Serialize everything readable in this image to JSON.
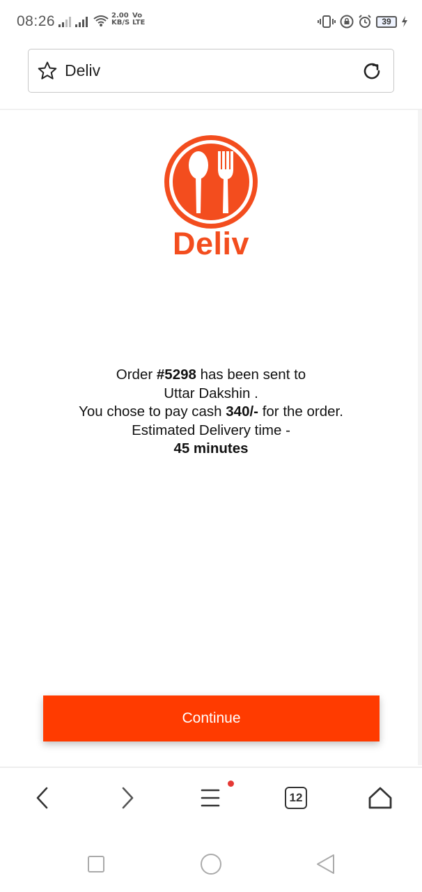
{
  "status_bar": {
    "time": "08:26",
    "speed_value": "2.00",
    "speed_unit": "KB/S",
    "network_top": "Vo",
    "network_bottom": "LTE",
    "battery": "39"
  },
  "browser": {
    "url_text": "Deliv",
    "tab_count": "12"
  },
  "brand": {
    "name": "Deliv",
    "color": "#f34d1e"
  },
  "message": {
    "order_prefix": "Order ",
    "order_number": "#5298",
    "order_suffix": " has been sent to",
    "restaurant": "Uttar Dakshin .",
    "pay_prefix": "You chose to pay cash ",
    "amount": "340/-",
    "pay_suffix": " for the order.",
    "eta_label": "Estimated Delivery time -",
    "eta_value": "45 minutes"
  },
  "actions": {
    "continue_label": "Continue",
    "continue_color": "#ff3b00"
  },
  "icons": {
    "address_left": "star-icon",
    "address_right": "reload-icon",
    "toolbar": [
      "back-icon",
      "forward-icon",
      "menu-icon",
      "tabs-icon",
      "home-icon"
    ],
    "system": [
      "recents-icon",
      "home-circle-icon",
      "back-triangle-icon"
    ]
  }
}
